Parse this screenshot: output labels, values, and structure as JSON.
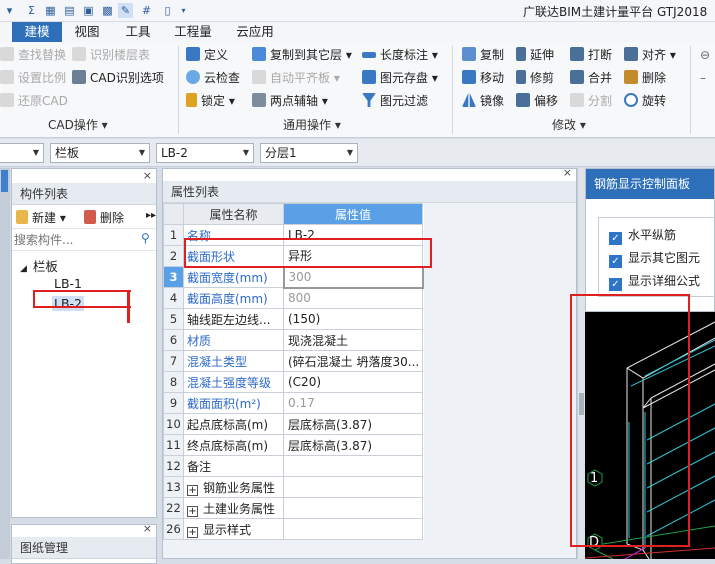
{
  "app": {
    "title": "广联达BIM土建计量平台 GTJ2018"
  },
  "menu": {
    "tabs": [
      "建模",
      "视图",
      "工具",
      "工程量",
      "云应用"
    ]
  },
  "ribbon": {
    "cad": {
      "items": [
        "查找替换",
        "识别楼层表",
        "设置比例",
        "CAD识别选项",
        "还原CAD"
      ],
      "label": "CAD操作"
    },
    "general": {
      "items": [
        "定义",
        "复制到其它层",
        "长度标注",
        "云检查",
        "自动平齐板",
        "图元存盘",
        "锁定",
        "两点辅轴",
        "图元过滤"
      ],
      "label": "通用操作"
    },
    "modify": {
      "items": [
        "复制",
        "延伸",
        "打断",
        "对齐",
        "移动",
        "修剪",
        "合并",
        "删除",
        "镜像",
        "偏移",
        "分割",
        "旋转"
      ],
      "label": "修改"
    }
  },
  "dropdowns": [
    "",
    "栏板",
    "LB-2",
    "分层1"
  ],
  "component_panel": {
    "title": "构件列表",
    "new_label": "新建",
    "delete_label": "删除",
    "search_placeholder": "搜索构件...",
    "tree": {
      "root": "栏板",
      "items": [
        "LB-1",
        "LB-2"
      ]
    }
  },
  "drawing_panel": {
    "title": "图纸管理"
  },
  "property_panel": {
    "title": "属性列表",
    "col_name": "属性名称",
    "col_value": "属性值",
    "rows": [
      {
        "num": "1",
        "name": "名称",
        "value": "LB-2"
      },
      {
        "num": "2",
        "name": "截面形状",
        "value": "异形"
      },
      {
        "num": "3",
        "name": "截面宽度(mm)",
        "value": "300"
      },
      {
        "num": "4",
        "name": "截面高度(mm)",
        "value": "800"
      },
      {
        "num": "5",
        "name": "轴线距左边线...",
        "value": "(150)"
      },
      {
        "num": "6",
        "name": "材质",
        "value": "现浇混凝土"
      },
      {
        "num": "7",
        "name": "混凝土类型",
        "value": "(碎石混凝土 坍落度30..."
      },
      {
        "num": "8",
        "name": "混凝土强度等级",
        "value": "(C20)"
      },
      {
        "num": "9",
        "name": "截面面积(m²)",
        "value": "0.17"
      },
      {
        "num": "10",
        "name": "起点底标高(m)",
        "value": "层底标高(3.87)"
      },
      {
        "num": "11",
        "name": "终点底标高(m)",
        "value": "层底标高(3.87)"
      },
      {
        "num": "12",
        "name": "备注",
        "value": ""
      },
      {
        "num": "13",
        "name": "钢筋业务属性",
        "value": ""
      },
      {
        "num": "22",
        "name": "土建业务属性",
        "value": ""
      },
      {
        "num": "26",
        "name": "显示样式",
        "value": ""
      }
    ]
  },
  "rebar_panel": {
    "title": "钢筋显示控制面板",
    "options": [
      "水平纵筋",
      "显示其它图元",
      "显示详细公式"
    ]
  },
  "viewport": {
    "axis_labels": [
      "1",
      "D"
    ]
  },
  "colors": {
    "accent": "#2e6fba",
    "annotation": "#e02020",
    "viewport_bg": "#000000",
    "rebar": "#2ec4d6"
  }
}
